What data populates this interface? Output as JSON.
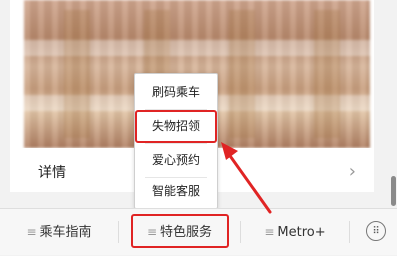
{
  "card": {
    "details_label": "详情"
  },
  "popup_menu": {
    "items": [
      {
        "label": "刷码乘车",
        "highlighted": false
      },
      {
        "label": "失物招领",
        "highlighted": true
      },
      {
        "label": "爱心预约",
        "highlighted": false
      },
      {
        "label": "智能客服",
        "highlighted": false
      }
    ]
  },
  "bottom_nav": {
    "items": [
      {
        "label": "乘车指南",
        "icon": "menu-icon"
      },
      {
        "label": "特色服务",
        "icon": "menu-icon",
        "highlighted": true
      },
      {
        "label": "Metro+",
        "icon": "menu-icon"
      }
    ],
    "keyboard_icon": "keyboard-icon"
  },
  "colors": {
    "highlight": "#e02424",
    "arrow": "#e02424"
  }
}
